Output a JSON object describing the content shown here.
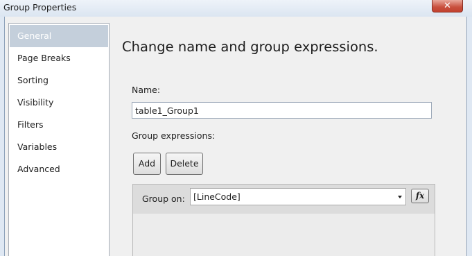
{
  "window": {
    "title": "Group Properties",
    "close_glyph": "✕"
  },
  "sidebar": {
    "items": [
      {
        "label": "General",
        "selected": true
      },
      {
        "label": "Page Breaks",
        "selected": false
      },
      {
        "label": "Sorting",
        "selected": false
      },
      {
        "label": "Visibility",
        "selected": false
      },
      {
        "label": "Filters",
        "selected": false
      },
      {
        "label": "Variables",
        "selected": false
      },
      {
        "label": "Advanced",
        "selected": false
      }
    ]
  },
  "main": {
    "heading": "Change name and group expressions.",
    "name_label": "Name:",
    "name_value": "table1_Group1",
    "group_expressions_label": "Group expressions:",
    "add_label": "Add",
    "delete_label": "Delete",
    "group_on_label": "Group on:",
    "group_on_value": "[LineCode]",
    "fx_label": "fx"
  },
  "colors": {
    "selected_nav": "#c4cfdb",
    "close_button": "#c8503e",
    "title_bar": "#dfe8f3"
  }
}
